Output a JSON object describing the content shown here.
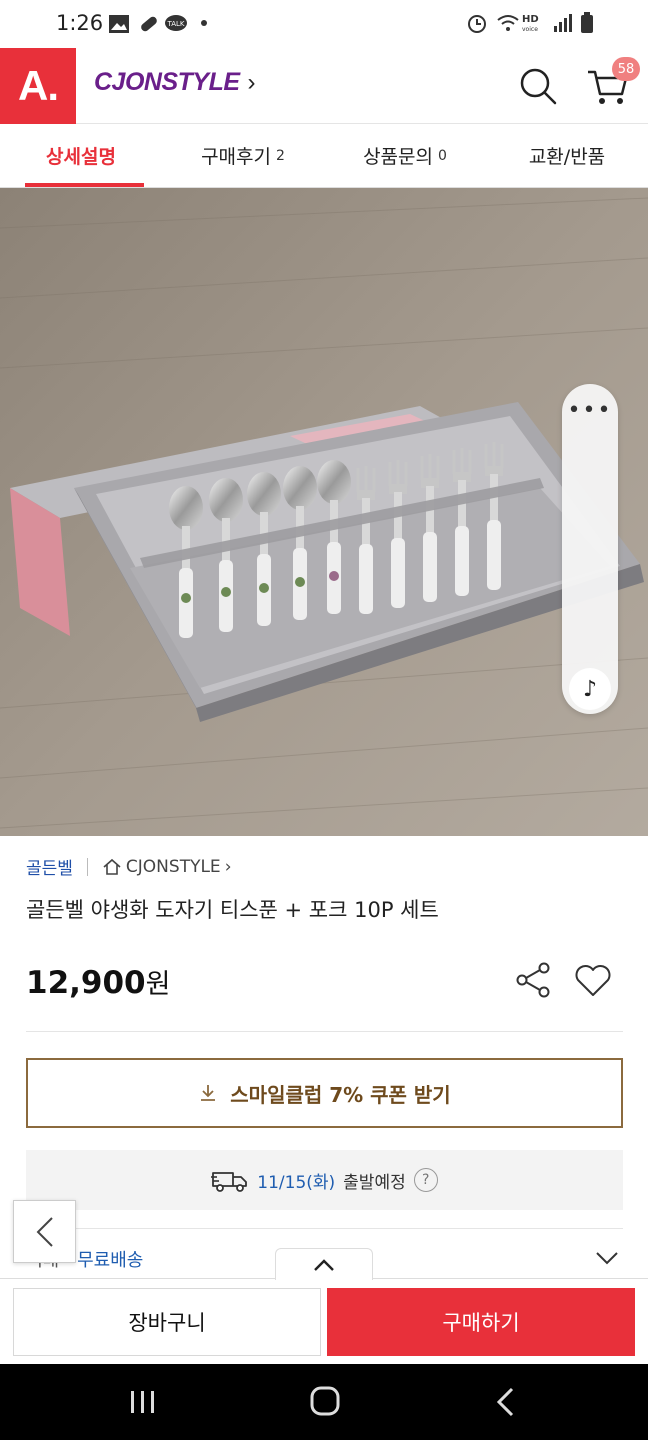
{
  "status_bar": {
    "time": "1:26"
  },
  "header": {
    "logo_text": "A.",
    "brand": "CJONSTYLE",
    "brand_chevron": "›",
    "cart_badge": "58",
    "icons": [
      "search-icon",
      "cart-icon"
    ]
  },
  "tabs": [
    {
      "label": "상세설명",
      "count": ""
    },
    {
      "label": "구매후기",
      "count": "2"
    },
    {
      "label": "상품문의",
      "count": "0"
    },
    {
      "label": "교환/반품",
      "count": ""
    }
  ],
  "side_panel": {
    "more_icon": "more-icon",
    "music_icon": "music-note-icon"
  },
  "product": {
    "brand": "골든벨",
    "shop": "CJONSTYLE",
    "shop_chevron": "›",
    "title": "골든벨 야생화 도자기 티스푼 + 포크 10P 세트",
    "price": "12,900",
    "currency": "원"
  },
  "coupon": {
    "label": "스마일클럽 7% 쿠폰 받기"
  },
  "shipping": {
    "date": "11/15(화)",
    "departure": "출발예정",
    "help": "?"
  },
  "delivery": {
    "label": "택배",
    "value": "무료배송"
  },
  "bottom": {
    "cart_label": "장바구니",
    "buy_label": "구매하기"
  },
  "colors": {
    "accent": "#e8303a",
    "brand_purple": "#6a1f8a",
    "link_blue": "#1f5db0",
    "coupon_brown": "#8b6a3e"
  }
}
